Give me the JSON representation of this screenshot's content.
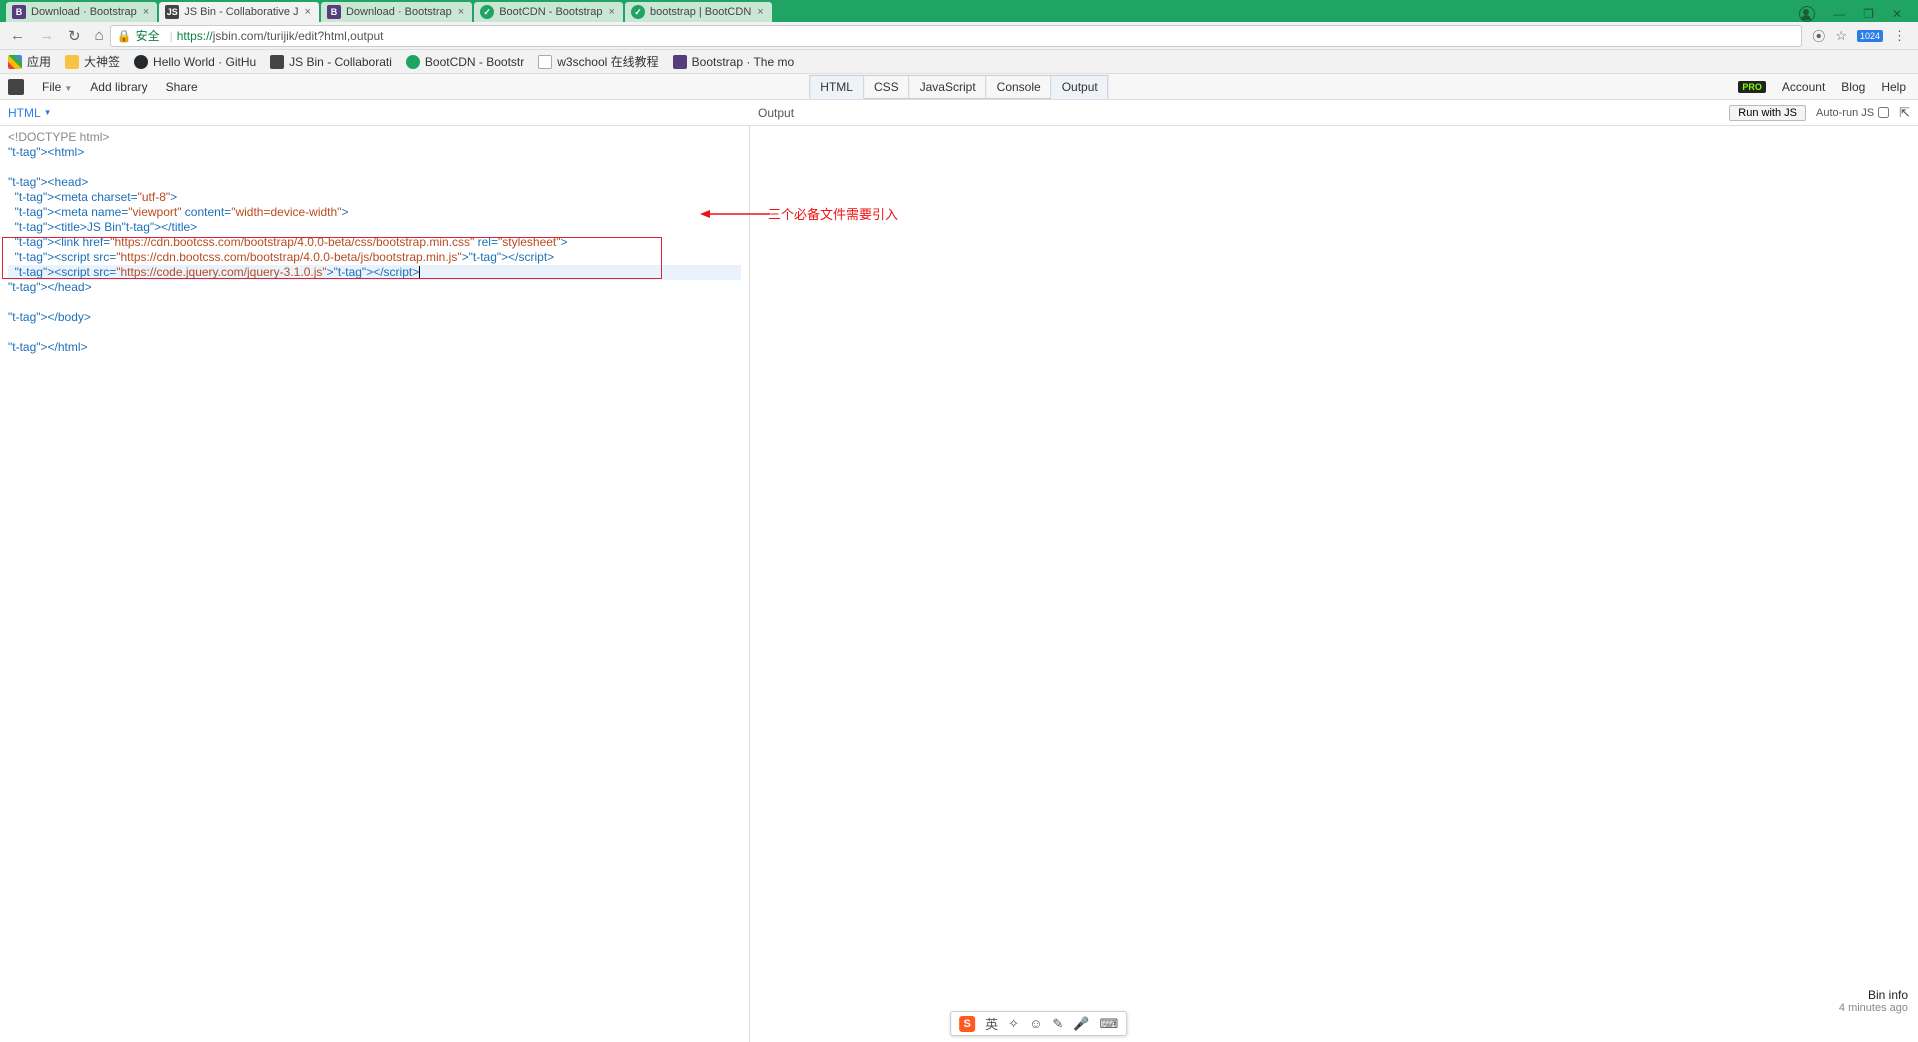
{
  "browser": {
    "tabs": [
      {
        "title": "Download · Bootstrap",
        "favicon": "b"
      },
      {
        "title": "JS Bin - Collaborative J",
        "favicon": "jsbin",
        "active": true
      },
      {
        "title": "Download · Bootstrap",
        "favicon": "b"
      },
      {
        "title": "BootCDN - Bootstrap",
        "favicon": "g"
      },
      {
        "title": "bootstrap | BootCDN",
        "favicon": "g"
      }
    ],
    "window_controls": {
      "min": "—",
      "max": "❐",
      "close": "✕"
    },
    "nav": {
      "back": "←",
      "fwd": "→",
      "reload": "↻",
      "home": "⌂"
    },
    "url": {
      "secure_label": "安全",
      "proto": "https://",
      "host": "jsbin.com",
      "path": "/turijik/edit?html,output"
    },
    "omni_right": {
      "translate": "⦿",
      "star": "☆",
      "badge": "1024",
      "menu": "⋮"
    },
    "bookmarks": [
      {
        "ico": "apps",
        "label": "应用"
      },
      {
        "ico": "folder",
        "label": "大神签"
      },
      {
        "ico": "gh",
        "label": "Hello World · GitHu"
      },
      {
        "ico": "jsbin",
        "label": "JS Bin - Collaborati"
      },
      {
        "ico": "bcdn",
        "label": "BootCDN - Bootstr"
      },
      {
        "ico": "page",
        "label": "w3school 在线教程"
      },
      {
        "ico": "bs",
        "label": "Bootstrap · The mo"
      }
    ]
  },
  "jsbin": {
    "menu": {
      "file": "File",
      "addlib": "Add library",
      "share": "Share"
    },
    "panels": {
      "html": "HTML",
      "css": "CSS",
      "js": "JavaScript",
      "console": "Console",
      "output": "Output"
    },
    "right": {
      "pro": "PRO",
      "account": "Account",
      "blog": "Blog",
      "help": "Help"
    },
    "panel_head_left": "HTML",
    "panel_head_right": "Output",
    "run_btn": "Run with JS",
    "autorun": "Auto-run JS",
    "bininfo_title": "Bin info",
    "bininfo_time": "4 minutes ago"
  },
  "code": {
    "l01": "<!DOCTYPE html>",
    "l02": "<html>",
    "l03": "<head>",
    "l04": "  <meta charset=\"utf-8\">",
    "l05": "  <meta name=\"viewport\" content=\"width=device-width\">",
    "l06": "  <title>JS Bin</title>",
    "l07": "  <link href=\"https://cdn.bootcss.com/bootstrap/4.0.0-beta/css/bootstrap.min.css\" rel=\"stylesheet\">",
    "l08": "  <script src=\"https://cdn.bootcss.com/bootstrap/4.0.0-beta/js/bootstrap.min.js\"></script>",
    "l09": "  <script src=\"https://code.jquery.com/jquery-3.1.0.js\"></script>",
    "l10": "</head>",
    "l11": "</body>",
    "l12": "</html>"
  },
  "annotation": "三个必备文件需要引入",
  "ime": {
    "lang": "英",
    "items": [
      "✧",
      "☺",
      "✎",
      "🎤",
      "⌨"
    ]
  }
}
